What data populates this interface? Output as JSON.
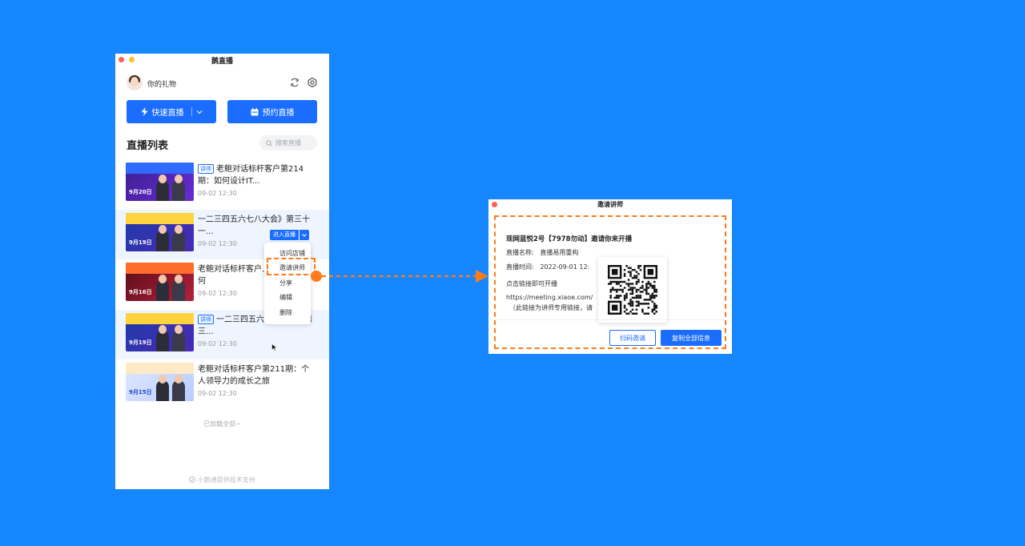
{
  "app": {
    "title": "鹅直播",
    "gift_label": "你的礼物",
    "fast_live_label": "快速直播",
    "book_live_label": "预约直播",
    "list_title": "直播列表",
    "search_placeholder": "搜索直播",
    "all_loaded": "已加载全部~",
    "footer": "小鹅通提供技术支持",
    "items": [
      {
        "tag": "讲师",
        "title": "老鲍对话标杆客户第214期：如何设计IT...",
        "time": "09-02 12:30",
        "thumb_date": "9月20日"
      },
      {
        "tag": "",
        "title": "一二三四五六七八大会》第三十一...",
        "time": "09-02 12:30",
        "thumb_date": "9月19日"
      },
      {
        "tag": "",
        "title": "老鲍对话标杆客户上音乐教育如何",
        "time": "09-02 12:30",
        "thumb_date": "9月16日"
      },
      {
        "tag": "讲师",
        "title": "一二三四五六吐槽大会》第三...",
        "time": "09-02 12:30",
        "thumb_date": "9月19日"
      },
      {
        "tag": "",
        "title": "老鲍对话标杆客户第211期：个人领导力的成长之旅",
        "time": "09-02 12:30",
        "thumb_date": "9月15日"
      }
    ],
    "enter_live": "进入直播",
    "menu": [
      "访问店铺",
      "邀请讲师",
      "分享",
      "编辑",
      "删除"
    ]
  },
  "dialog": {
    "title": "邀请讲师",
    "heading": "现网蓝悦2号【7978勿动】邀请你来开播",
    "name_label": "直播名称:",
    "name_value": "直播易用重构",
    "time_label": "直播时间:",
    "time_value": "2022-09-01 12:",
    "click_text": "点击链接即可开播",
    "link": "https://meeting.xiaoe.com/",
    "note": "（此链接为讲师专用链接，请",
    "scan_button": "扫码邀请",
    "copy_button": "复制全部信息"
  },
  "colors": {
    "background": "#1687ff",
    "primary": "#1a6dff",
    "highlight": "#ff7a1a"
  }
}
